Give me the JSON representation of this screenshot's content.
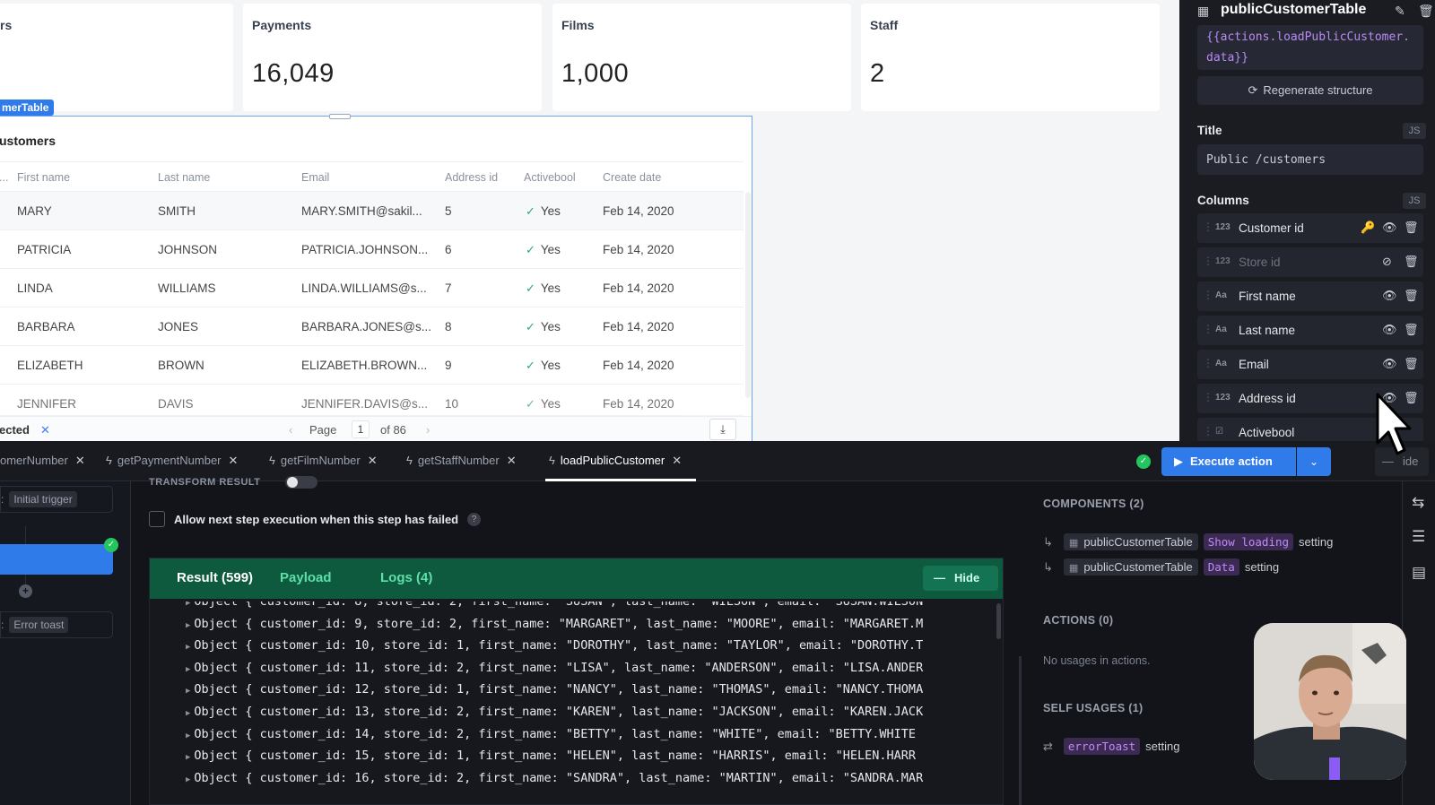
{
  "stats": [
    {
      "id": "customers",
      "label": "rs",
      "value": ""
    },
    {
      "id": "payments",
      "label": "Payments",
      "value": "16,049"
    },
    {
      "id": "films",
      "label": "Films",
      "value": "1,000"
    },
    {
      "id": "staff",
      "label": "Staff",
      "value": "2"
    }
  ],
  "table": {
    "tag": "merTable",
    "title": "ustomers",
    "columns": [
      "...",
      "First name",
      "Last name",
      "Email",
      "Address id",
      "Activebool",
      "Create date"
    ],
    "rows": [
      {
        "first": "MARY",
        "last": "SMITH",
        "email": "MARY.SMITH@sakil...",
        "address": "5",
        "active": "Yes",
        "date": "Feb 14, 2020"
      },
      {
        "first": "PATRICIA",
        "last": "JOHNSON",
        "email": "PATRICIA.JOHNSON...",
        "address": "6",
        "active": "Yes",
        "date": "Feb 14, 2020"
      },
      {
        "first": "LINDA",
        "last": "WILLIAMS",
        "email": "LINDA.WILLIAMS@s...",
        "address": "7",
        "active": "Yes",
        "date": "Feb 14, 2020"
      },
      {
        "first": "BARBARA",
        "last": "JONES",
        "email": "BARBARA.JONES@s...",
        "address": "8",
        "active": "Yes",
        "date": "Feb 14, 2020"
      },
      {
        "first": "ELIZABETH",
        "last": "BROWN",
        "email": "ELIZABETH.BROWN...",
        "address": "9",
        "active": "Yes",
        "date": "Feb 14, 2020"
      },
      {
        "first": "JENNIFER",
        "last": "DAVIS",
        "email": "JENNIFER.DAVIS@s...",
        "address": "10",
        "active": "Yes",
        "date": "Feb 14, 2020"
      }
    ],
    "footer": {
      "selected": "ected",
      "page_label": "Page",
      "page": "1",
      "of": "of 86"
    }
  },
  "props": {
    "title": "publicCustomerTable",
    "code_line1": "{{actions.loadPublicCustomer.",
    "code_line2": "data}}",
    "regen_label": "Regenerate structure",
    "title_section": "Title",
    "js_badge": "JS",
    "title_value": "Public /customers",
    "columns_section": "Columns",
    "columns": [
      {
        "type": "123",
        "name": "Customer id",
        "key": true,
        "hidden": false
      },
      {
        "type": "123",
        "name": "Store id",
        "key": false,
        "hidden": true
      },
      {
        "type": "Aa",
        "name": "First name",
        "key": false,
        "hidden": false
      },
      {
        "type": "Aa",
        "name": "Last name",
        "key": false,
        "hidden": false
      },
      {
        "type": "Aa",
        "name": "Email",
        "key": false,
        "hidden": false
      },
      {
        "type": "123",
        "name": "Address id",
        "key": false,
        "hidden": false
      },
      {
        "type": "☑",
        "name": "Activebool",
        "key": false,
        "hidden": false
      }
    ]
  },
  "tabs": [
    {
      "name": "omerNumber",
      "active": false
    },
    {
      "name": "getPaymentNumber",
      "active": false
    },
    {
      "name": "getFilmNumber",
      "active": false
    },
    {
      "name": "getStaffNumber",
      "active": false
    },
    {
      "name": "loadPublicCustomer",
      "active": true
    }
  ],
  "toolbar": {
    "execute_label": "Execute action",
    "hide_label": "ide"
  },
  "steps": {
    "trigger_label": "Initial trigger",
    "error_label": "Error toast"
  },
  "config": {
    "transform_label": "TRANSFORM RESULT",
    "allow_label": "Allow next step execution when this step has failed"
  },
  "results": {
    "tab_result": "Result (599)",
    "tab_payload": "Payload",
    "tab_logs": "Logs (4)",
    "hide_label": "Hide",
    "lines": [
      "Object { customer_id: 8, store_id: 2, first_name: \"SUSAN\", last_name: \"WILSON\", email: \"SUSAN.WILSON",
      "Object { customer_id: 9, store_id: 2, first_name: \"MARGARET\", last_name: \"MOORE\", email: \"MARGARET.M",
      "Object { customer_id: 10, store_id: 1, first_name: \"DOROTHY\", last_name: \"TAYLOR\", email: \"DOROTHY.T",
      "Object { customer_id: 11, store_id: 2, first_name: \"LISA\", last_name: \"ANDERSON\", email: \"LISA.ANDER",
      "Object { customer_id: 12, store_id: 1, first_name: \"NANCY\", last_name: \"THOMAS\", email: \"NANCY.THOMA",
      "Object { customer_id: 13, store_id: 2, first_name: \"KAREN\", last_name: \"JACKSON\", email: \"KAREN.JACK",
      "Object { customer_id: 14, store_id: 2, first_name: \"BETTY\", last_name: \"WHITE\", email: \"BETTY.WHITE",
      "Object { customer_id: 15, store_id: 1, first_name: \"HELEN\", last_name: \"HARRIS\", email: \"HELEN.HARR",
      "Object { customer_id: 16, store_id: 2, first_name: \"SANDRA\", last_name: \"MARTIN\", email: \"SANDRA.MAR"
    ]
  },
  "usages": {
    "components_head": "COMPONENTS (2)",
    "components": [
      {
        "widget": "publicCustomerTable",
        "code": "Show loading",
        "setting": "setting"
      },
      {
        "widget": "publicCustomerTable",
        "code": "Data",
        "setting": "setting"
      }
    ],
    "actions_head": "ACTIONS (0)",
    "no_usage": "No usages in actions.",
    "self_head": "SELF USAGES (1)",
    "self": {
      "code": "errorToast",
      "setting": "setting"
    }
  },
  "colors": {
    "accent": "#2f7bea",
    "success": "#22c55e",
    "results_header": "#0d5a3f"
  }
}
